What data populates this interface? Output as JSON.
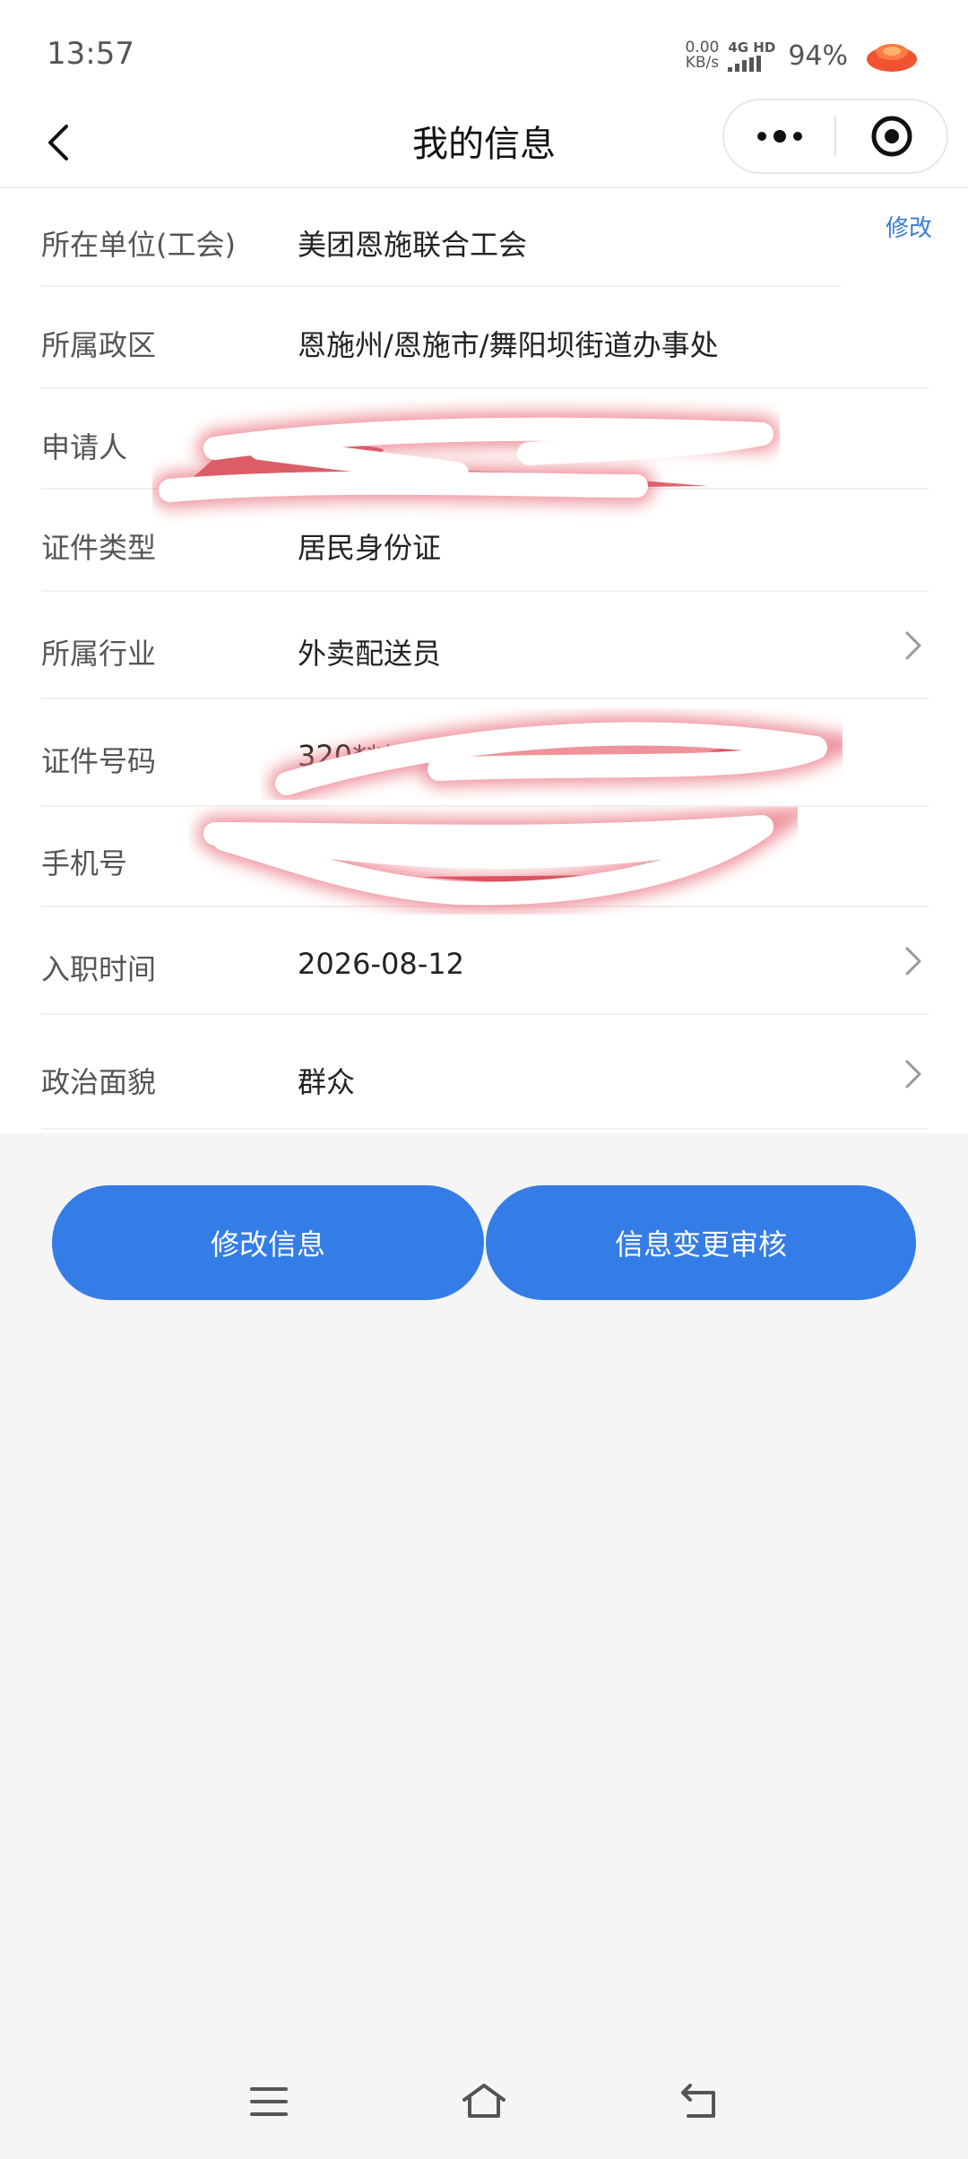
{
  "status_bar": {
    "time": "13:57",
    "net_speed_value": "0.00",
    "net_speed_unit": "KB/s",
    "net_type": "4G HD",
    "battery": "94%"
  },
  "nav": {
    "title": "我的信息",
    "back_icon": "chevron-left-icon",
    "more_icon": "more-dots-icon",
    "close_icon": "target-circle-icon"
  },
  "info": {
    "edit_label": "修改",
    "rows": [
      {
        "label": "所在单位(工会)",
        "value": "美团恩施联合工会"
      },
      {
        "label": "所属政区",
        "value": "恩施州/恩施市/舞阳坝街道办事处"
      },
      {
        "label": "申请人",
        "value": ""
      },
      {
        "label": "证件类型",
        "value": "居民身份证"
      },
      {
        "label": "所属行业",
        "value": "外卖配送员"
      },
      {
        "label": "证件号码",
        "value": "320*****"
      },
      {
        "label": "手机号",
        "value": ""
      },
      {
        "label": "入职时间",
        "value": "2026-08-12"
      },
      {
        "label": "政治面貌",
        "value": "群众"
      }
    ]
  },
  "actions": {
    "edit_info": "修改信息",
    "change_review": "信息变更审核"
  },
  "colors": {
    "primary": "#357de6",
    "link": "#3a7bd5",
    "background": "#f5f5f5"
  }
}
